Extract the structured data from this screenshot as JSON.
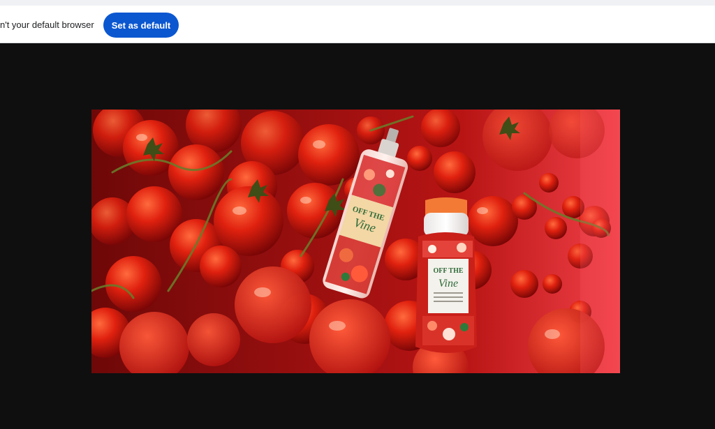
{
  "infobar": {
    "message": "n't your default browser",
    "button_label": "Set as default"
  },
  "image": {
    "product_1_brand_line1": "OFF THE",
    "product_1_brand_line2": "Vine",
    "product_2_brand_line1": "OFF THE",
    "product_2_brand_line2": "Vine",
    "colors": {
      "tomato": "#d81f10",
      "background": "#e8323a",
      "accent_blue": "#0b57d0"
    }
  }
}
